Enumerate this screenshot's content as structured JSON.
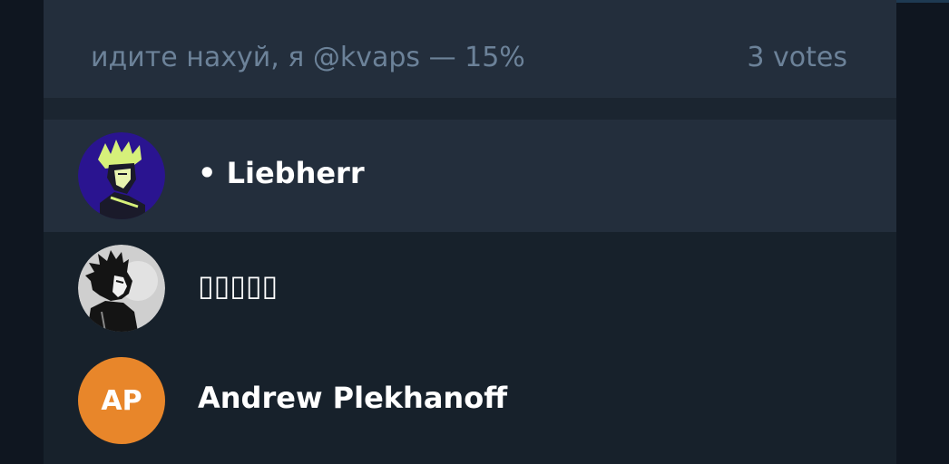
{
  "poll_option": {
    "text": "идите нахуй, я @kvaps — 15%",
    "votes": "3 votes"
  },
  "voters": [
    {
      "name": "• Liebherr",
      "avatar_icon": "anime-character-avatar-icon",
      "avatar_bg": "#2a1490"
    },
    {
      "name": "▯▯▯▯▯",
      "avatar_icon": "bw-portrait-avatar-icon",
      "avatar_bg": "#cfcfcf"
    },
    {
      "name": "Andrew Plekhanoff",
      "avatar_initials": "AP",
      "avatar_bg": "#e8862a"
    }
  ],
  "colors": {
    "panel": "#17212b",
    "row_highlight": "#232e3c",
    "muted_text": "#6c8299",
    "name_text": "#ffffff"
  }
}
